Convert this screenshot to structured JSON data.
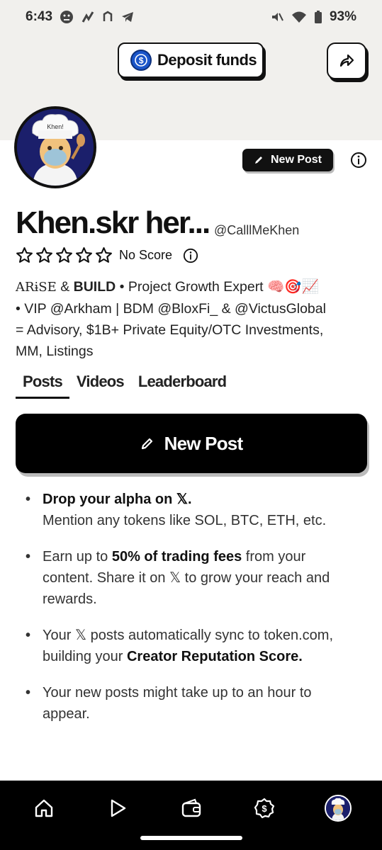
{
  "status_bar": {
    "time": "6:43",
    "battery": "93%"
  },
  "header": {
    "deposit_label": "Deposit funds",
    "new_post_label": "New Post"
  },
  "profile": {
    "name": "Khen.skr her...",
    "handle": "@CalllMeKhen",
    "score_label": "No Score",
    "avatar_hat_text": "Khen!",
    "stars_filled": 0,
    "stars_total": 5,
    "bio": {
      "line1_prefix": "ARɨSE",
      "line1_amp": " & ",
      "line1_build": "BUILD",
      "line1_rest": " • Project Growth Expert 🧠🎯📈",
      "line2": "• VIP @Arkham | BDM @BloxFi_ & @VictusGlobal",
      "line3": "= Advisory, $1B+ Private Equity/OTC Investments,",
      "line4": "MM, Listings"
    }
  },
  "tabs": [
    {
      "label": "Posts",
      "active": true
    },
    {
      "label": "Videos",
      "active": false
    },
    {
      "label": "Leaderboard",
      "active": false
    }
  ],
  "main": {
    "new_post_label": "New Post",
    "bullets": [
      {
        "bold_lead": "Drop your alpha on 𝕏.",
        "text": "Mention any tokens like SOL, BTC, ETH, etc."
      },
      {
        "pre": "Earn up to ",
        "bold": "50% of trading fees",
        "post": " from your content. Share it on 𝕏 to grow your reach and rewards."
      },
      {
        "pre": "Your 𝕏 posts automatically sync to token.com, building your ",
        "bold": "Creator Reputation Score."
      },
      {
        "pre": "Your new posts might take up to an hour to appear."
      }
    ]
  },
  "bottom_nav": [
    "home-icon",
    "play-icon",
    "wallet-icon",
    "dollar-badge-icon",
    "profile-avatar"
  ],
  "colors": {
    "header_bg": "#f1f0ed",
    "accent_blue": "#1a55c9",
    "avatar_bg": "#1b1f6b"
  }
}
